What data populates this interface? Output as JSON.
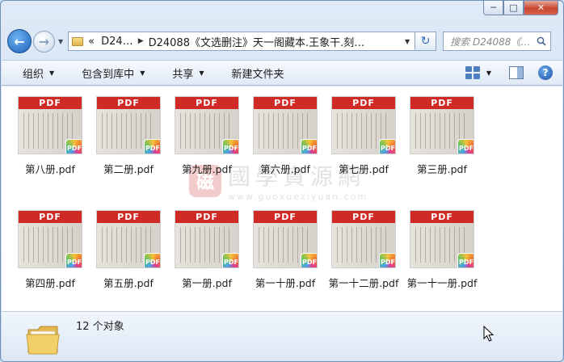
{
  "window": {
    "minimize": "─",
    "maximize": "□",
    "close": "✕"
  },
  "nav": {
    "back_icon": "arrow-left",
    "forward_icon": "arrow-right",
    "address_prefix": "«",
    "crumbs": [
      "D24…",
      "D24088《文选删注》天一阁藏本.王象干.刻…"
    ],
    "refresh_icon": "refresh",
    "search_placeholder": "搜索 D24088《…"
  },
  "toolbar": {
    "organize": "组织",
    "include_library": "包含到库中",
    "share": "共享",
    "new_folder": "新建文件夹"
  },
  "watermark": {
    "seal": "磁",
    "title": "國學資源網",
    "url": "www.guoxueziyuan.com"
  },
  "files": [
    {
      "name": "第八册.pdf",
      "band": "PDF",
      "badge": "PDF"
    },
    {
      "name": "第二册.pdf",
      "band": "PDF",
      "badge": "PDF"
    },
    {
      "name": "第九册.pdf",
      "band": "PDF",
      "badge": "PDF"
    },
    {
      "name": "第六册.pdf",
      "band": "PDF",
      "badge": "PDF"
    },
    {
      "name": "第七册.pdf",
      "band": "PDF",
      "badge": "PDF"
    },
    {
      "name": "第三册.pdf",
      "band": "PDF",
      "badge": "PDF"
    },
    {
      "name": "第四册.pdf",
      "band": "PDF",
      "badge": "PDF"
    },
    {
      "name": "第五册.pdf",
      "band": "PDF",
      "badge": "PDF"
    },
    {
      "name": "第一册.pdf",
      "band": "PDF",
      "badge": "PDF"
    },
    {
      "name": "第一十册.pdf",
      "band": "PDF",
      "badge": "PDF"
    },
    {
      "name": "第一十二册.pdf",
      "band": "PDF",
      "badge": "PDF"
    },
    {
      "name": "第一十一册.pdf",
      "band": "PDF",
      "badge": "PDF"
    }
  ],
  "status": {
    "count_text": "12 个对象"
  }
}
